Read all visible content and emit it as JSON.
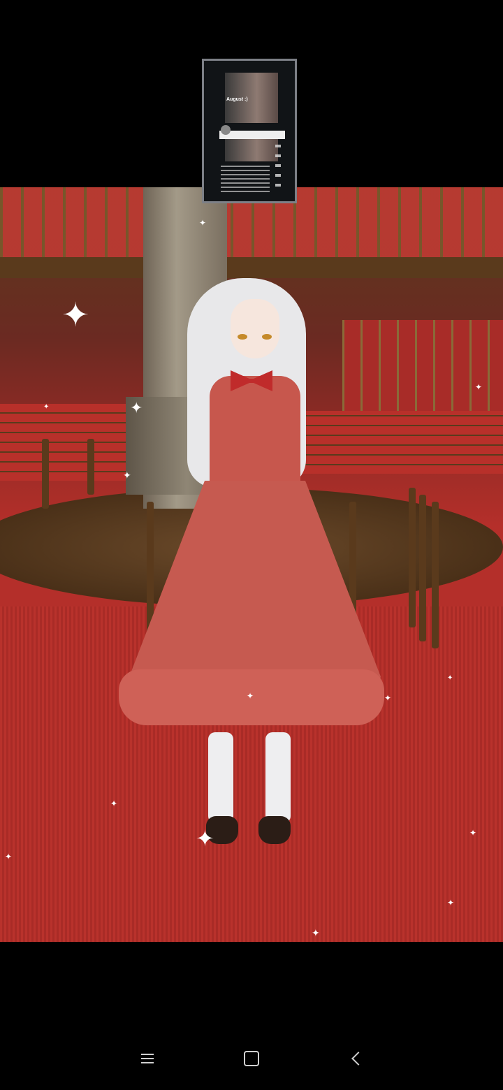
{
  "thumbnail": {
    "caption": "August :)"
  },
  "navbar": {
    "recents_icon": "menu-icon",
    "home_icon": "square-icon",
    "back_icon": "chevron-left-icon"
  },
  "colors": {
    "carpet": "#b9322c",
    "dress": "#c65a50",
    "bow": "#c02b2b",
    "hair": "#e8e8ea"
  }
}
